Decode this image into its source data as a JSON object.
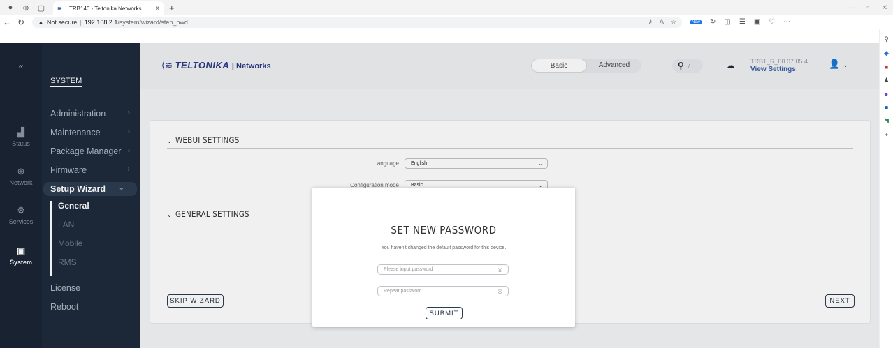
{
  "browser": {
    "tab_title": "TRB140 - Teltonika Networks",
    "tab_close": "×",
    "new_tab": "+",
    "security_label": "Not secure",
    "url_host": "192.168.2.1",
    "url_path": "/system/wizard/step_pwd",
    "new_badge": "New"
  },
  "rail": {
    "collapse": "«",
    "items": [
      {
        "label": "Status",
        "icon": "signal-icon"
      },
      {
        "label": "Network",
        "icon": "globe-icon"
      },
      {
        "label": "Services",
        "icon": "gear-icon"
      },
      {
        "label": "System",
        "icon": "system-icon"
      }
    ]
  },
  "sidebar": {
    "section": "SYSTEM",
    "items": [
      {
        "label": "Administration",
        "chevron": "›"
      },
      {
        "label": "Maintenance",
        "chevron": "›"
      },
      {
        "label": "Package Manager",
        "chevron": "›"
      },
      {
        "label": "Firmware",
        "chevron": "›"
      },
      {
        "label": "Setup Wizard",
        "chevron": "⌄"
      }
    ],
    "sub_items": [
      "General",
      "LAN",
      "Mobile",
      "RMS"
    ],
    "bottom_items": [
      "License",
      "Reboot"
    ]
  },
  "header": {
    "logo_brand": "TELTONIKA",
    "logo_suffix": "| Networks",
    "mode_basic": "Basic",
    "mode_advanced": "Advanced",
    "search_shortcut": "/",
    "firmware": "TRB1_R_00.07.05.4",
    "view_settings": "View Settings"
  },
  "content": {
    "webui_title": "WEBUI SETTINGS",
    "language_label": "Language",
    "language_value": "English",
    "config_label": "Configuration mode",
    "config_value": "Basic",
    "general_title": "GENERAL SETTINGS",
    "skip_label": "SKIP WIZARD",
    "next_label": "NEXT"
  },
  "modal": {
    "title": "SET NEW PASSWORD",
    "subtitle": "You haven't changed the default password for this device.",
    "password_placeholder": "Please input password",
    "repeat_placeholder": "Repeat password",
    "submit_label": "SUBMIT"
  },
  "colors": {
    "sidebar_bg": "#1e2b3c",
    "rail_bg": "#1a2535",
    "brand": "#2b3a86"
  }
}
